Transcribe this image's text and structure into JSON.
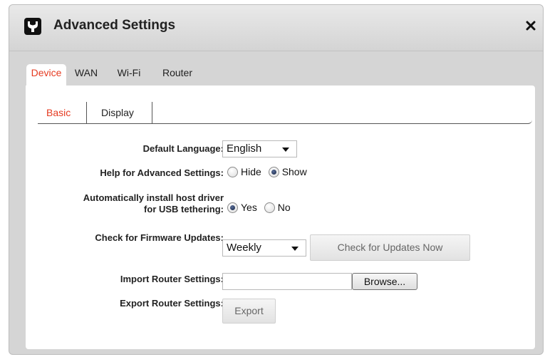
{
  "dialog": {
    "title": "Advanced Settings",
    "icon": "wrench-icon",
    "close": "close-icon"
  },
  "main_tabs": [
    {
      "label": "Device",
      "active": true
    },
    {
      "label": "WAN",
      "active": false
    },
    {
      "label": "Wi-Fi",
      "active": false
    },
    {
      "label": "Router",
      "active": false
    }
  ],
  "sub_tabs": [
    {
      "label": "Basic",
      "active": true
    },
    {
      "label": "Display",
      "active": false
    }
  ],
  "settings": {
    "language": {
      "label": "Default Language:",
      "value": "English"
    },
    "help": {
      "label": "Help for Advanced Settings:",
      "options": [
        "Hide",
        "Show"
      ],
      "selected": "Show"
    },
    "usb_driver": {
      "label_line1": "Automatically install host driver",
      "label_line2": "for USB tethering:",
      "options": [
        "Yes",
        "No"
      ],
      "selected": "Yes"
    },
    "firmware": {
      "label": "Check for Firmware Updates:",
      "value": "Weekly",
      "button": "Check for Updates Now"
    },
    "import": {
      "label": "Import Router Settings:",
      "value": "",
      "button": "Browse..."
    },
    "export": {
      "label": "Export Router Settings:",
      "button": "Export"
    }
  },
  "colors": {
    "accent": "#e53b21",
    "chrome": "#d5d5d5"
  }
}
